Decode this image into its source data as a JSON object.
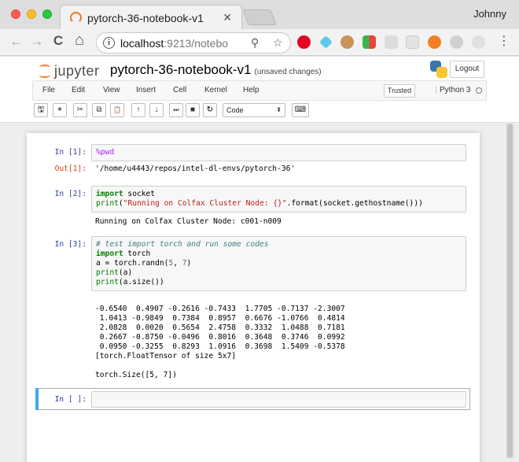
{
  "browser": {
    "tab_title": "pytorch-36-notebook-v1",
    "tab_close": "✕",
    "user": "Johnny",
    "url_host": "localhost",
    "url_rest": ":9213/notebo",
    "info_glyph": "i",
    "icons": [
      "back-icon",
      "forward-icon",
      "reload-icon",
      "home-icon",
      "info-icon",
      "search-icon",
      "star-icon",
      "pinterest-icon",
      "diamond-icon",
      "cookie-icon",
      "grid-icon",
      "mail-icon",
      "office-icon",
      "stack-icon",
      "pie-icon",
      "settings-icon",
      "menu-icon"
    ],
    "nav_glyphs": {
      "back": "←",
      "forward": "→",
      "reload": "C",
      "home": "⌂",
      "search": "⚲",
      "star": "☆",
      "menu": "⋮"
    }
  },
  "header": {
    "logo_text": "jupyter",
    "title": "pytorch-36-notebook-v1",
    "unsaved": "(unsaved changes)",
    "logout": "Logout"
  },
  "menu": {
    "items": [
      "File",
      "Edit",
      "View",
      "Insert",
      "Cell",
      "Kernel",
      "Help"
    ],
    "trusted": "Trusted",
    "kernel": "Python 3"
  },
  "toolbar": {
    "buttons": [
      {
        "name": "save-icon",
        "glyph": "🖫"
      },
      {
        "name": "add-cell-icon",
        "glyph": "+"
      },
      {
        "name": "cut-icon",
        "glyph": "✂"
      },
      {
        "name": "copy-icon",
        "glyph": "⧉"
      },
      {
        "name": "paste-icon",
        "glyph": "📋"
      },
      {
        "name": "move-up-icon",
        "glyph": "↑"
      },
      {
        "name": "move-down-icon",
        "glyph": "↓"
      },
      {
        "name": "run-icon",
        "glyph": "⏭"
      },
      {
        "name": "stop-icon",
        "glyph": "■"
      },
      {
        "name": "restart-icon",
        "glyph": "↻"
      },
      {
        "name": "keyboard-icon",
        "glyph": "⌨"
      }
    ],
    "cell_type": "Code",
    "cell_type_arrow": "⬍"
  },
  "cells": [
    {
      "in_prompt": "In [1]:",
      "out_prompt": "Out[1]:",
      "code": "%pwd",
      "output": "'/home/u4443/repos/intel-dl-envs/pytorch-36'"
    },
    {
      "in_prompt": "In [2]:",
      "code_line1_kw": "import",
      "code_line1_rest": " socket",
      "code_line2_bi": "print",
      "code_line2_a": "(",
      "code_line2_str": "\"Running on Colfax Cluster Node: {}\"",
      "code_line2_b": ".format(socket.gethostname()))",
      "output": "Running on Colfax Cluster Node: c001-n009"
    },
    {
      "in_prompt": "In [3]:",
      "comment": "# test import torch and run some codes",
      "l2_kw": "import",
      "l2_rest": " torch",
      "l3_a": "a = torch.randn(",
      "l3_n1": "5",
      "l3_c": ", ",
      "l3_n2": "7",
      "l3_e": ")",
      "l4_bi": "print",
      "l4_rest": "(a)",
      "l5_bi": "print",
      "l5_rest": "(a.size())",
      "output": "-0.6540  0.4907 -0.2616 -0.7433  1.7705 -0.7137 -2.3007\n 1.0413 -0.9849  0.7384  0.8957  0.6676 -1.0766  0.4814\n 2.0828  0.0020  0.5654  2.4758  0.3332  1.0488  0.7181\n 0.2667 -0.8750 -0.0496  0.8016  0.3648  0.3746  0.0992\n 0.0950 -0.3255  0.8293  1.0916  0.3698  1.5409 -0.5378\n[torch.FloatTensor of size 5x7]\n\ntorch.Size([5, 7])"
    },
    {
      "in_prompt": "In [ ]:"
    }
  ]
}
